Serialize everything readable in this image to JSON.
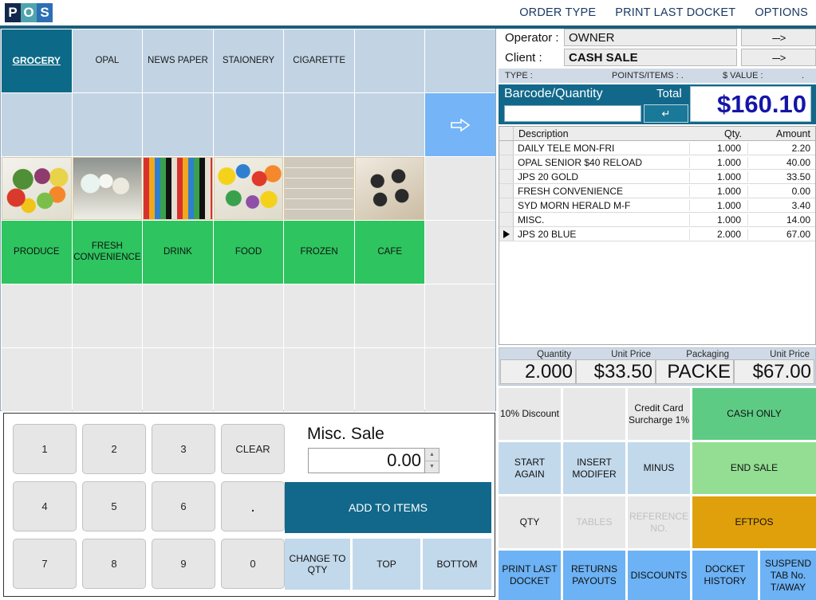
{
  "app": {
    "logo_letters": [
      "P",
      "O",
      "S"
    ],
    "accent_teal": "#11688a",
    "accent_navy": "#1515a8"
  },
  "topmenu": {
    "items": [
      {
        "label": "ORDER TYPE"
      },
      {
        "label": "PRINT LAST DOCKET"
      },
      {
        "label": "OPTIONS"
      }
    ]
  },
  "categories": {
    "row1": [
      {
        "label": "GROCERY",
        "selected": true
      },
      {
        "label": "OPAL",
        "selected": false
      },
      {
        "label": "NEWS PAPER",
        "selected": false
      },
      {
        "label": "STAIONERY",
        "selected": false
      },
      {
        "label": "CIGARETTE",
        "selected": false
      },
      {
        "label": "",
        "selected": false
      },
      {
        "label": "",
        "selected": false
      }
    ],
    "row2": [
      {
        "label": ""
      },
      {
        "label": ""
      },
      {
        "label": ""
      },
      {
        "label": ""
      },
      {
        "label": ""
      },
      {
        "label": ""
      },
      {
        "label": "",
        "icon": "arrow-right-icon"
      }
    ],
    "images": [
      {
        "alt": "produce-photo"
      },
      {
        "alt": "dairy-photo"
      },
      {
        "alt": "drinks-photo"
      },
      {
        "alt": "snacks-photo"
      },
      {
        "alt": "frozen-photo"
      },
      {
        "alt": "cafe-photo"
      },
      {
        "alt": ""
      }
    ],
    "departments": [
      {
        "label": "PRODUCE"
      },
      {
        "label": "FRESH CONVENIENCE"
      },
      {
        "label": "DRINK"
      },
      {
        "label": "FOOD"
      },
      {
        "label": "FROZEN"
      },
      {
        "label": "CAFE"
      },
      {
        "label": ""
      }
    ]
  },
  "keypad": {
    "keys": [
      "1",
      "2",
      "3",
      "CLEAR",
      "4",
      "5",
      "6",
      ".",
      "7",
      "8",
      "9",
      "0"
    ],
    "misc_sale_label": "Misc. Sale",
    "misc_sale_value": "0.00",
    "add_to_items": "ADD TO ITEMS",
    "change_to_qty": "CHANGE TO QTY",
    "top": "TOP",
    "bottom": "BOTTOM"
  },
  "sale": {
    "operator_label": "Operator :",
    "operator_value": "OWNER",
    "client_label": "Client :",
    "client_value": "CASH SALE",
    "arrow_label": "--->",
    "type_label": "TYPE :",
    "points_label": "POINTS/ITEMS : .",
    "value_label": "$ VALUE :",
    "value_dot": ".",
    "barcode_label": "Barcode/Quantity",
    "barcode_value": "",
    "enter_glyph": "↵",
    "total_label": "Total",
    "total_value": "$160.10"
  },
  "items": {
    "columns": [
      "Description",
      "Qty.",
      "Amount"
    ],
    "rows": [
      {
        "desc": "DAILY TELE MON-FRI",
        "qty": "1.000",
        "amount": "2.20",
        "selected": false
      },
      {
        "desc": "OPAL SENIOR $40 RELOAD",
        "qty": "1.000",
        "amount": "40.00",
        "selected": false
      },
      {
        "desc": "JPS 20 GOLD",
        "qty": "1.000",
        "amount": "33.50",
        "selected": false
      },
      {
        "desc": "FRESH CONVENIENCE",
        "qty": "1.000",
        "amount": "0.00",
        "selected": false
      },
      {
        "desc": "SYD MORN HERALD M-F",
        "qty": "1.000",
        "amount": "3.40",
        "selected": false
      },
      {
        "desc": "MISC.",
        "qty": "1.000",
        "amount": "14.00",
        "selected": false
      },
      {
        "desc": "JPS 20 BLUE",
        "qty": "2.000",
        "amount": "67.00",
        "selected": true
      }
    ]
  },
  "detail_strip": {
    "labels": [
      "Quantity",
      "Unit Price",
      "Packaging",
      "Unit Price"
    ],
    "values": [
      "2.000",
      "$33.50",
      "PACKE",
      "$67.00"
    ]
  },
  "actions": {
    "grid": [
      {
        "label": "10% Discount",
        "style": "grey",
        "disabled": false
      },
      {
        "label": "",
        "style": "grey",
        "disabled": false
      },
      {
        "label": "Credit Card Surcharge 1%",
        "style": "grey",
        "disabled": false
      },
      {
        "label": "CASH ONLY",
        "style": "green-dark",
        "disabled": false
      },
      {
        "label": "START AGAIN",
        "style": "blue",
        "disabled": false
      },
      {
        "label": "INSERT MODIFER",
        "style": "blue",
        "disabled": false
      },
      {
        "label": "MINUS",
        "style": "blue",
        "disabled": false
      },
      {
        "label": "END SALE",
        "style": "green-light",
        "disabled": false
      },
      {
        "label": "QTY",
        "style": "grey",
        "disabled": false
      },
      {
        "label": "TABLES",
        "style": "grey",
        "disabled": true
      },
      {
        "label": "REFERENCE NO.",
        "style": "grey",
        "disabled": true
      },
      {
        "label": "EFTPOS",
        "style": "orange",
        "disabled": false
      }
    ],
    "bottom": [
      {
        "label": "PRINT LAST DOCKET"
      },
      {
        "label": "RETURNS PAYOUTS"
      },
      {
        "label": "DISCOUNTS"
      },
      {
        "label": "DOCKET HISTORY"
      },
      {
        "label": "SUSPEND TAB No. T/AWAY"
      }
    ]
  }
}
